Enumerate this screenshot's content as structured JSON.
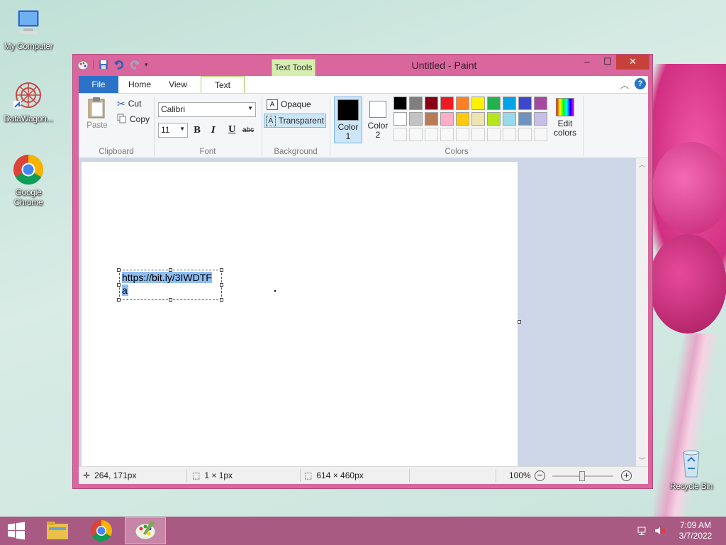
{
  "desktop": {
    "icons": [
      {
        "label": "My Computer"
      },
      {
        "label": "DataWagon..."
      },
      {
        "label": "Google Chrome"
      },
      {
        "label": "Recycle Bin"
      }
    ]
  },
  "window": {
    "title": "Untitled - Paint",
    "context_tab_group": "Text Tools",
    "tabs": {
      "file": "File",
      "home": "Home",
      "view": "View",
      "text": "Text"
    },
    "controls": {
      "minimize": "–",
      "maximize": "☐",
      "close": "✕"
    }
  },
  "ribbon": {
    "clipboard": {
      "paste": "Paste",
      "cut": "Cut",
      "copy": "Copy",
      "label": "Clipboard"
    },
    "font": {
      "family": "Calibri",
      "size": "11",
      "bold": "B",
      "italic": "I",
      "underline": "U",
      "strike": "abc",
      "label": "Font"
    },
    "background": {
      "opaque": "Opaque",
      "transparent": "Transparent",
      "label": "Background"
    },
    "colors": {
      "color1_label": "Color",
      "color1_num": "1",
      "color2_label": "Color",
      "color2_num": "2",
      "edit_label": "Edit",
      "edit_label2": "colors",
      "label": "Colors",
      "palette_row1": [
        "#000000",
        "#7f7f7f",
        "#880015",
        "#ed1c24",
        "#ff7f27",
        "#fff200",
        "#22b14c",
        "#00a2e8",
        "#3f48cc",
        "#a349a4"
      ],
      "palette_row2": [
        "#ffffff",
        "#c3c3c3",
        "#b97a57",
        "#ffaec9",
        "#ffc90e",
        "#efe4b0",
        "#b5e61d",
        "#99d9ea",
        "#7092be",
        "#c8bfe7"
      ],
      "color1": "#000000",
      "color2": "#ffffff"
    }
  },
  "canvas": {
    "text_line1": "https://bit.ly/3IWDTF",
    "text_line2": "a"
  },
  "status": {
    "cursor_pos": "264, 171px",
    "selection_size": "1 × 1px",
    "image_size": "614 × 460px",
    "zoom": "100%"
  },
  "taskbar": {
    "time": "7:09 AM",
    "date": "3/7/2022"
  }
}
